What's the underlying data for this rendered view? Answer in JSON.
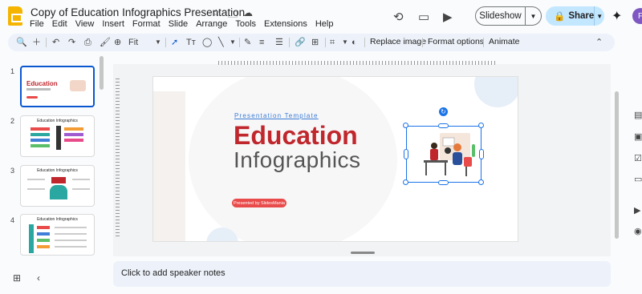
{
  "header": {
    "doc_title": "Copy of Education Infographics Presentation",
    "menu": [
      "File",
      "Edit",
      "View",
      "Insert",
      "Format",
      "Slide",
      "Arrange",
      "Tools",
      "Extensions",
      "Help"
    ],
    "slideshow_label": "Slideshow",
    "share_label": "Share",
    "avatar_initial": "F"
  },
  "toolbar": {
    "zoom": "Fit",
    "replace_image": "Replace image",
    "format_options": "Format options",
    "animate": "Animate"
  },
  "filmstrip": {
    "slides": [
      {
        "num": "1",
        "title": "Education"
      },
      {
        "num": "2",
        "title": "Education Infographics"
      },
      {
        "num": "3",
        "title": "Education Infographics"
      },
      {
        "num": "4",
        "title": "Education Infographics"
      }
    ]
  },
  "slide": {
    "kicker": "Presentation Template",
    "title": "Education",
    "subtitle": "Infographics",
    "presented_by": "Presented by SlidesMania"
  },
  "notes": {
    "placeholder": "Click to add speaker notes"
  },
  "colors": {
    "accent": "#0b57d0",
    "title_red": "#c0272d",
    "share_bg": "#c2e7ff"
  }
}
